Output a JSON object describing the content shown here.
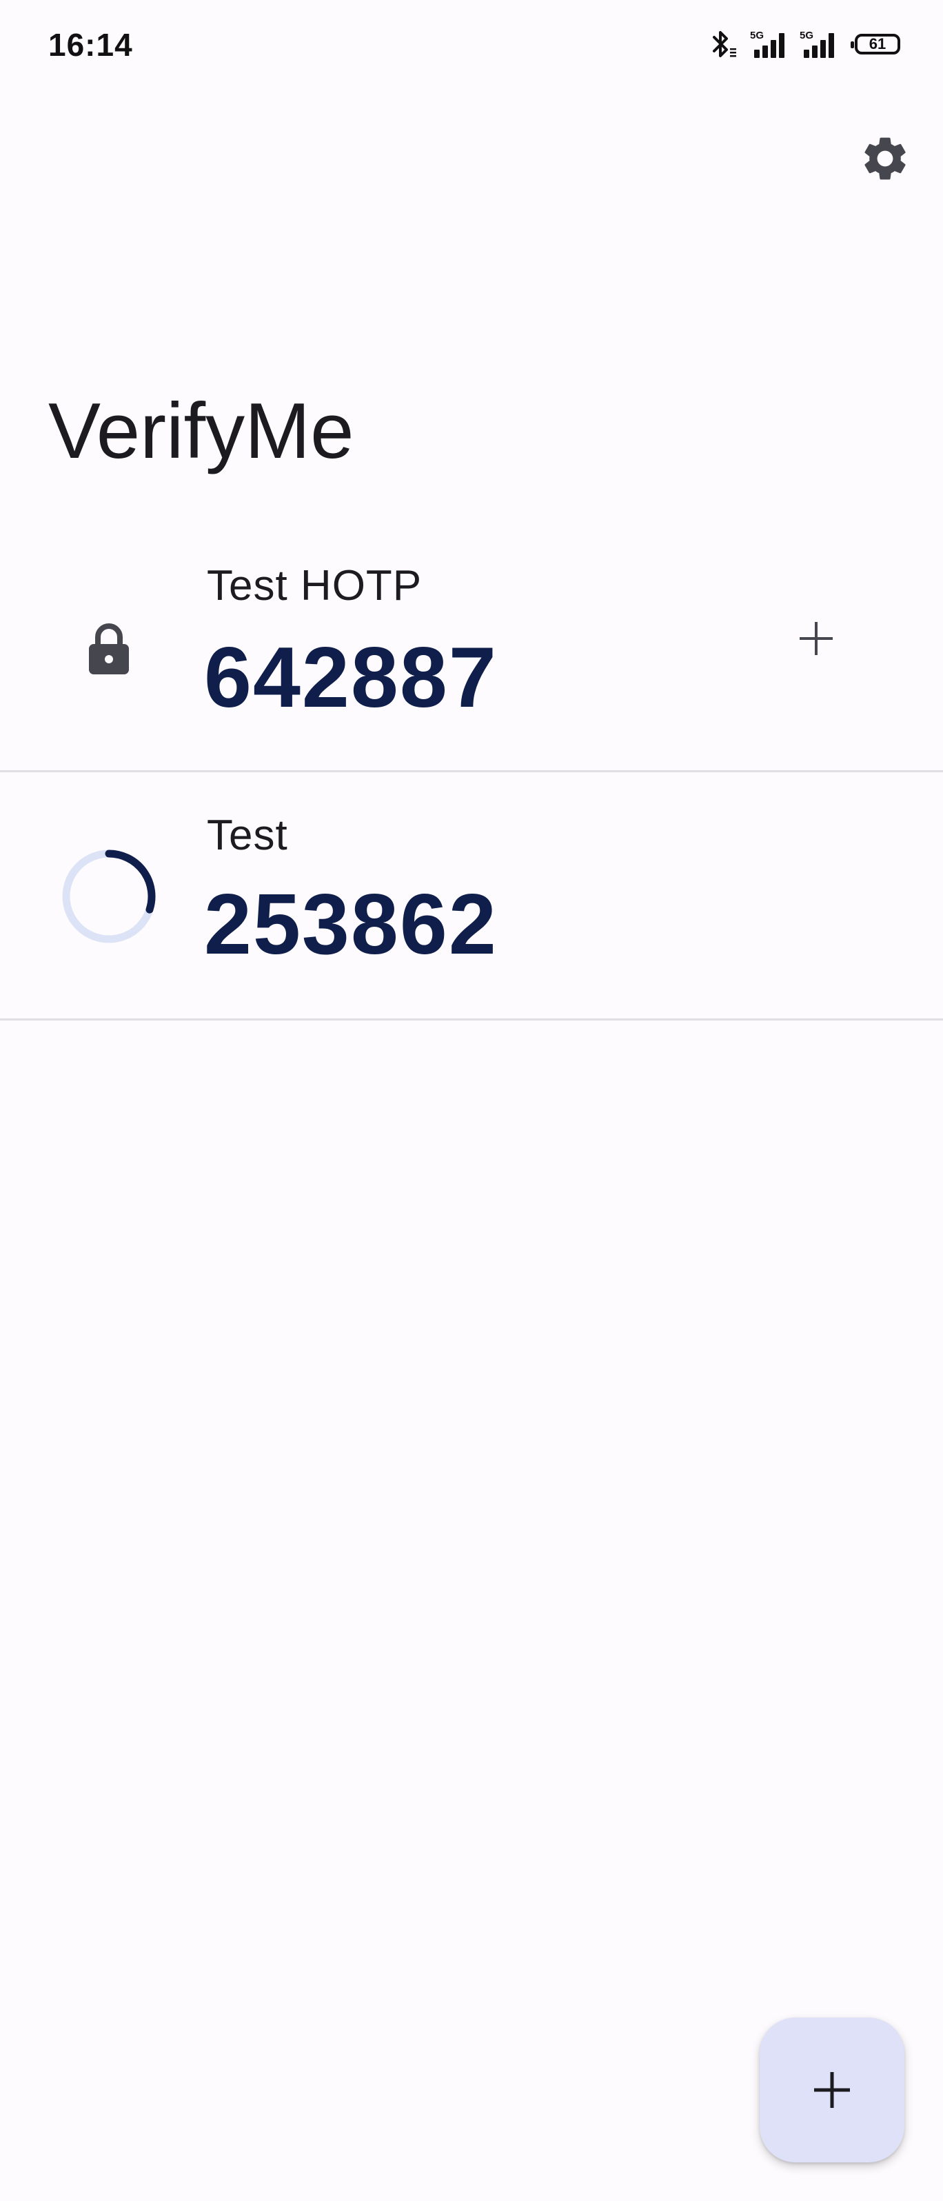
{
  "status_bar": {
    "time": "16:14",
    "battery_level": "61",
    "icons": [
      "bluetooth-icon",
      "signal-5g-icon",
      "signal-5g-icon",
      "battery-icon"
    ]
  },
  "app": {
    "title": "VerifyMe",
    "settings_icon": "gear-icon"
  },
  "tokens": [
    {
      "name": "Test HOTP",
      "code": "642887",
      "type_icon": "lock-icon",
      "action_icon": "plus-icon"
    },
    {
      "name": "Test",
      "code": "253862",
      "type_icon": "countdown-progress-icon",
      "progress_remaining": 0.3
    }
  ],
  "fab": {
    "icon": "plus-icon"
  },
  "colors": {
    "code_text": "#0f1e4a",
    "fab_background": "#dee1f8",
    "progress_active": "#0f1e4a",
    "progress_track": "#dde3f6",
    "background": "#fdfbfd"
  }
}
